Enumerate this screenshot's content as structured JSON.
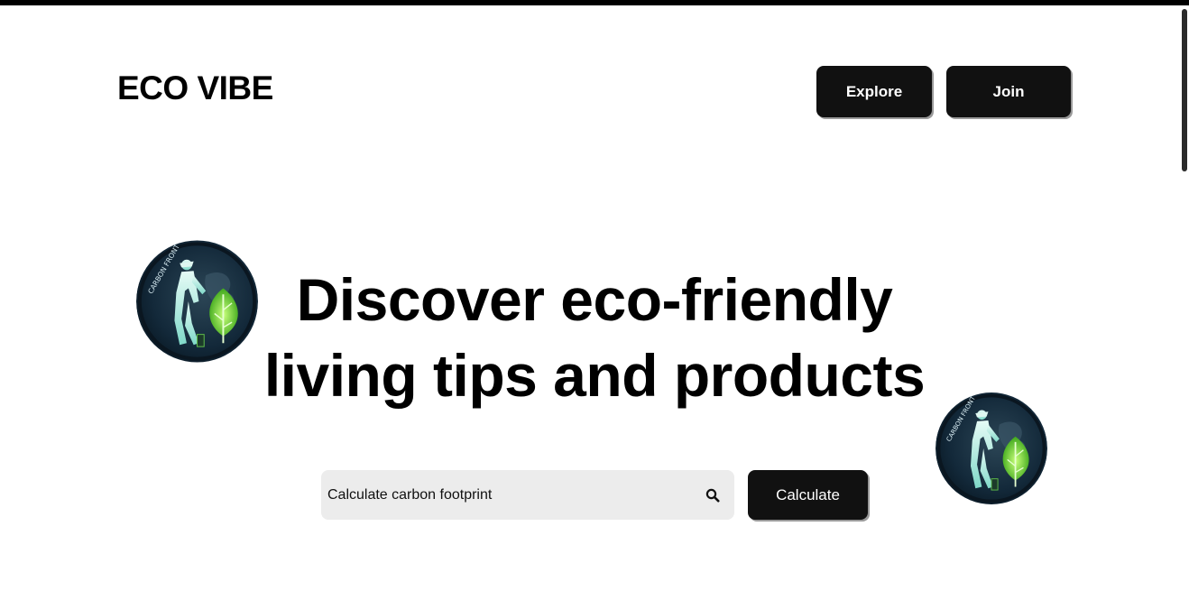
{
  "header": {
    "logo_text": "ECO VIBE",
    "nav": {
      "explore_label": "Explore",
      "join_label": "Join"
    }
  },
  "hero": {
    "title_line1": "Discover eco-friendly",
    "title_line2": "living tips and products",
    "badge_icon": "carbon-footprint-badge-icon",
    "badge_text": "CARBON FRONT"
  },
  "calculator": {
    "input_placeholder": "Calculate carbon footprint",
    "input_value": "",
    "search_icon": "search-icon",
    "button_label": "Calculate"
  },
  "colors": {
    "background": "#ffffff",
    "button_bg": "#111111",
    "button_text": "#ffffff",
    "input_bg": "#ececec",
    "text": "#000000",
    "badge_dark": "#0f2233",
    "badge_leaf": "#7ed321"
  }
}
